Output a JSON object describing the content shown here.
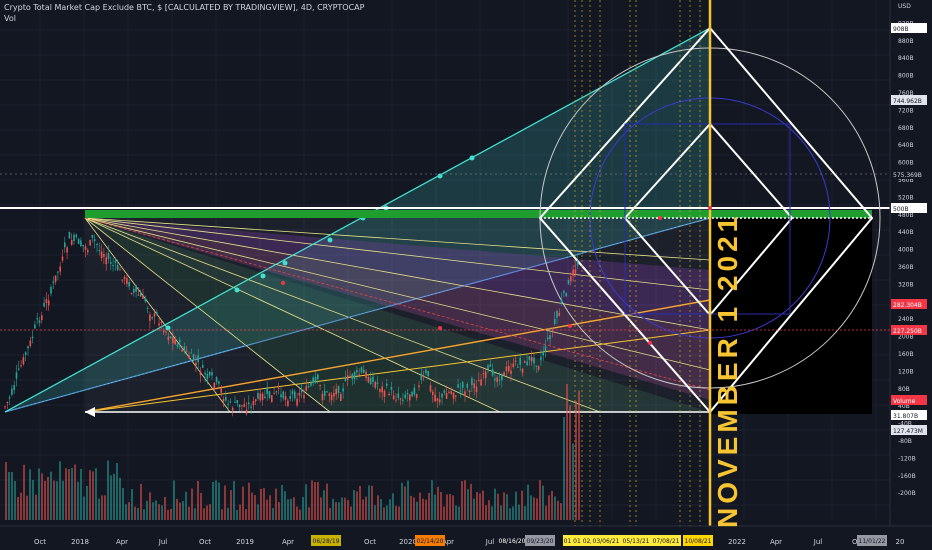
{
  "header": {
    "title": "Crypto Total Market Cap Exclude BTC, $ [CALCULATED BY TRADINGVIEW], 4D, CRYPTOCAP",
    "sub": "Vol"
  },
  "annotation": "NOVEMBER 1 2021",
  "price_axis": {
    "ticks": [
      "USD",
      "920B",
      "880B",
      "840B",
      "800B",
      "760B",
      "720B",
      "680B",
      "640B",
      "600B",
      "560B",
      "520B",
      "480B",
      "440B",
      "400B",
      "360B",
      "320B",
      "280B",
      "240B",
      "200B",
      "160B",
      "120B",
      "80B",
      "40B",
      "-40B",
      "-80B",
      "-120B",
      "-160B",
      "-200B"
    ],
    "markers": [
      {
        "label": "908B",
        "color": "#ffffff",
        "bg": "#ffffff",
        "fg": "#131722"
      },
      {
        "label": "744.962B",
        "color": "#9598a1",
        "bg": "#e0e3eb",
        "fg": "#131722"
      },
      {
        "label": "575.369B",
        "color": "#9598a1",
        "bg": "#131722",
        "fg": "#d1d4dc"
      },
      {
        "label": "500B",
        "color": "#ffffff",
        "bg": "#ffffff",
        "fg": "#131722"
      },
      {
        "label": "282.304B",
        "color": "#f23645",
        "bg": "#f23645",
        "fg": "#ffffff"
      },
      {
        "label": "227.250B",
        "color": "#f23645",
        "bg": "#f23645",
        "fg": "#ffffff"
      },
      {
        "label": "Volume",
        "color": "#f23645",
        "bg": "#f23645",
        "fg": "#ffffff"
      },
      {
        "label": "31.807B",
        "color": "#ffffff",
        "bg": "#ffffff",
        "fg": "#131722"
      },
      {
        "label": "127.473M",
        "color": "#9598a1",
        "bg": "#e0e3eb",
        "fg": "#131722"
      }
    ]
  },
  "time_axis": {
    "ticks": [
      "Oct",
      "2018",
      "Apr",
      "Jul",
      "Oct",
      "2019",
      "Apr",
      "Jul",
      "Oct",
      "2020",
      "Apr",
      "Jul",
      "Oct",
      "2022",
      "Apr",
      "Jul",
      "Oct",
      "20"
    ],
    "date_badges": [
      "06/28/19",
      "02/14/20",
      "08/16/20",
      "09/23/20",
      "01 01 02/",
      "03/06/21",
      "05/13/21",
      "07/08/21",
      "10/08/21",
      "11/01/22"
    ]
  },
  "colors": {
    "bg": "#131722",
    "bull": "#26a69a",
    "bear": "#ef5350",
    "gold": "#f7c531",
    "green_band": "#1f9d2f",
    "cyan": "#40e0d0"
  }
}
